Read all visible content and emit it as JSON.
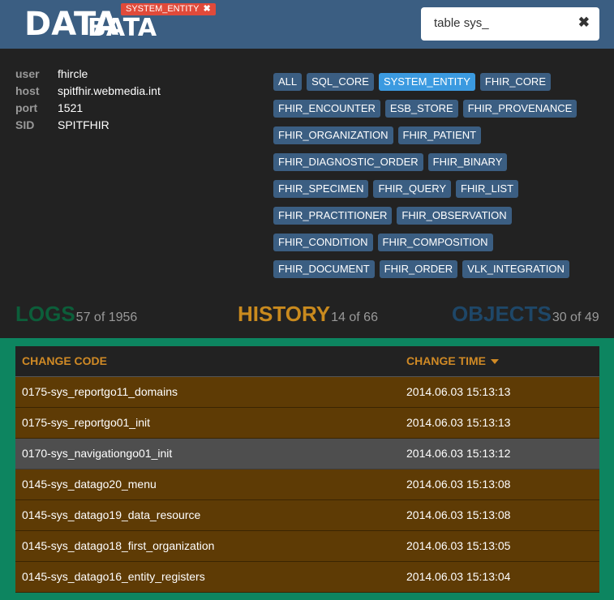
{
  "header": {
    "logo_word1": "DATA",
    "logo_word2": "BATA",
    "active_entity": "SYSTEM_ENTITY",
    "search": {
      "value": "table sys_",
      "clear": "✖"
    }
  },
  "connection": [
    {
      "key": "user",
      "value": "fhircle"
    },
    {
      "key": "host",
      "value": "spitfhir.webmedia.int"
    },
    {
      "key": "port",
      "value": "1521"
    },
    {
      "key": "SID",
      "value": "SPITFHIR"
    }
  ],
  "tags": {
    "rows": [
      [
        "ALL",
        "SQL_CORE",
        "SYSTEM_ENTITY",
        "FHIR_CORE"
      ],
      [
        "FHIR_ENCOUNTER",
        "ESB_STORE",
        "FHIR_PROVENANCE"
      ],
      [
        "FHIR_ORGANIZATION",
        "FHIR_PATIENT"
      ],
      [
        "FHIR_DIAGNOSTIC_ORDER",
        "FHIR_BINARY"
      ],
      [
        "FHIR_SPECIMEN",
        "FHIR_QUERY",
        "FHIR_LIST"
      ],
      [
        "FHIR_PRACTITIONER",
        "FHIR_OBSERVATION"
      ],
      [
        "FHIR_CONDITION",
        "FHIR_COMPOSITION"
      ],
      [
        "FHIR_DOCUMENT",
        "FHIR_ORDER",
        "VLK_INTEGRATION"
      ]
    ],
    "active": "SYSTEM_ENTITY"
  },
  "sections": {
    "logs": {
      "label": "LOGS",
      "count": "57 of 1956"
    },
    "history": {
      "label": "HISTORY",
      "count": "14 of 66"
    },
    "objects": {
      "label": "OBJECTS",
      "count": "30 of 49"
    }
  },
  "table": {
    "col_code": "CHANGE CODE",
    "col_time": "CHANGE TIME",
    "rows": [
      {
        "code": "0175-sys_reportgo11_domains",
        "time": "2014.06.03 15:13:13"
      },
      {
        "code": "0175-sys_reportgo01_init",
        "time": "2014.06.03 15:13:13"
      },
      {
        "code": "0170-sys_navigationgo01_init",
        "time": "2014.06.03 15:13:12"
      },
      {
        "code": "0145-sys_datago20_menu",
        "time": "2014.06.03 15:13:08"
      },
      {
        "code": "0145-sys_datago19_data_resource",
        "time": "2014.06.03 15:13:08"
      },
      {
        "code": "0145-sys_datago18_first_organization",
        "time": "2014.06.03 15:13:05"
      },
      {
        "code": "0145-sys_datago16_entity_registers",
        "time": "2014.06.03 15:13:04"
      }
    ],
    "selected_index": 2
  },
  "colors": {
    "header_bg": "#3b5e82",
    "tag_bg": "#3b5e82",
    "tag_active": "#3b9ae0",
    "logs": "#0c5e3a",
    "history": "#c98a1e",
    "objects": "#1e4768",
    "panel_bg": "#0d8560",
    "row_bg": "#5e3b05"
  }
}
